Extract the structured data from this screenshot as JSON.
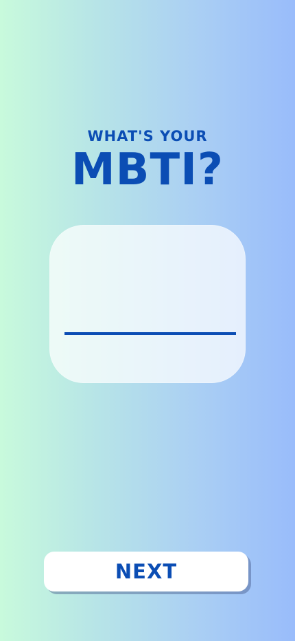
{
  "headline": {
    "small": "WHAT'S YOUR",
    "large": "MBTI?"
  },
  "input": {
    "value": "",
    "placeholder": ""
  },
  "actions": {
    "next": "NEXT"
  },
  "colors": {
    "accent": "#0b4db4"
  }
}
